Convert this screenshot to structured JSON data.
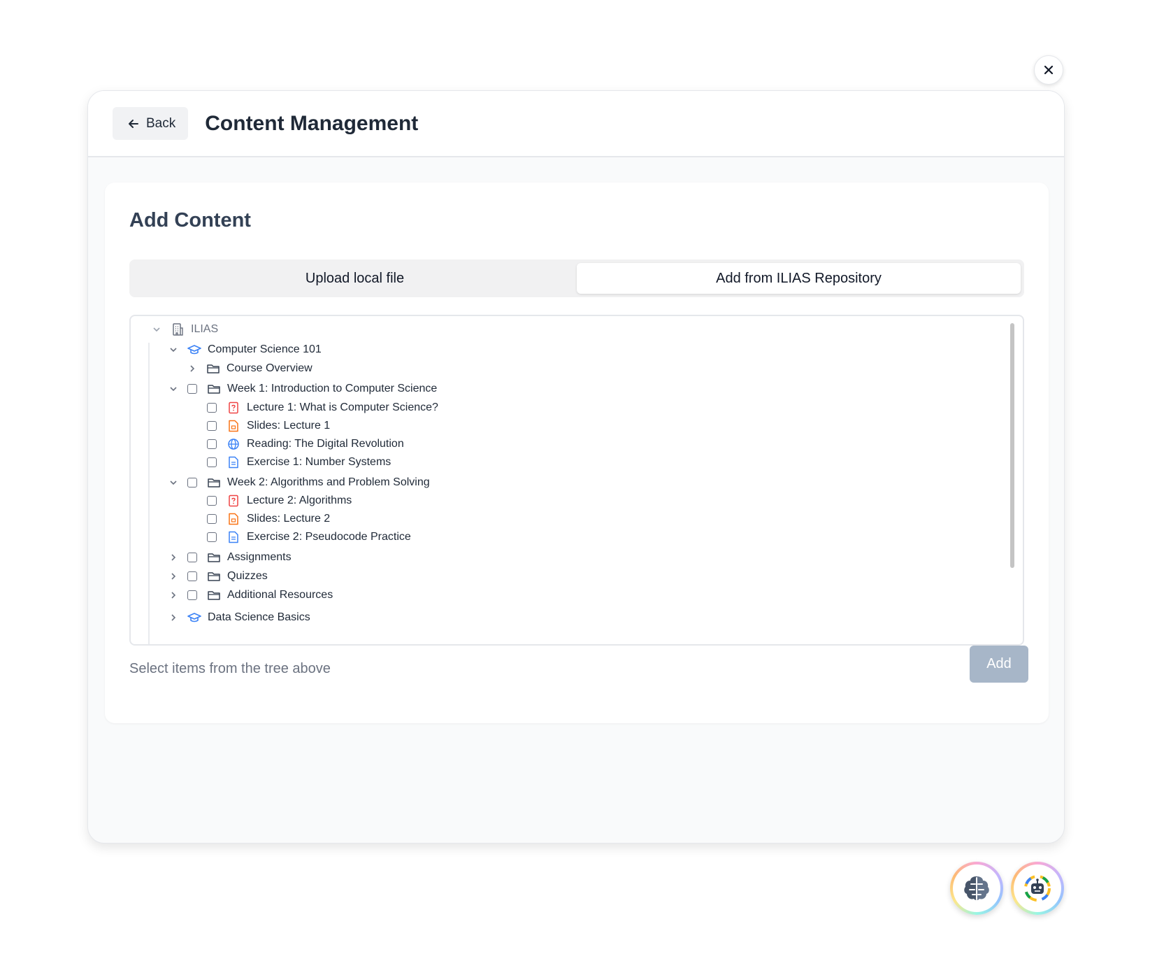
{
  "header": {
    "back_label": "Back",
    "title": "Content Management"
  },
  "card": {
    "title": "Add Content",
    "tabs": [
      {
        "label": "Upload local file",
        "active": false
      },
      {
        "label": "Add from ILIAS Repository",
        "active": true
      }
    ],
    "tree": {
      "root": "ILIAS",
      "course_1": "Computer Science 101",
      "course_overview": "Course Overview",
      "week1": "Week 1: Introduction to Computer Science",
      "week1_items": [
        "Lecture 1: What is Computer Science?",
        "Slides: Lecture 1",
        "Reading: The Digital Revolution",
        "Exercise 1: Number Systems"
      ],
      "week2": "Week 2: Algorithms and Problem Solving",
      "week2_items": [
        "Lecture 2: Algorithms",
        "Slides: Lecture 2",
        "Exercise 2: Pseudocode Practice"
      ],
      "assignments": "Assignments",
      "quizzes": "Quizzes",
      "additional": "Additional Resources",
      "course_2": "Data Science Basics"
    },
    "footer_text": "Select items from the tree above",
    "add_label": "Add"
  },
  "icons": {
    "close": "close-icon",
    "back": "arrow-left-icon",
    "root": "building-icon",
    "course": "graduation-cap-icon",
    "folder": "folder-icon",
    "lecture": "file-question-icon",
    "slides": "file-slides-icon",
    "reading": "globe-icon",
    "exercise": "file-text-icon",
    "fab_left": "brain-icon",
    "fab_right": "robot-icon"
  },
  "colors": {
    "accent_blue": "#3b82f6",
    "lecture_red": "#ef4444",
    "slides_orange": "#f97316",
    "add_disabled": "#a7b6c8"
  }
}
